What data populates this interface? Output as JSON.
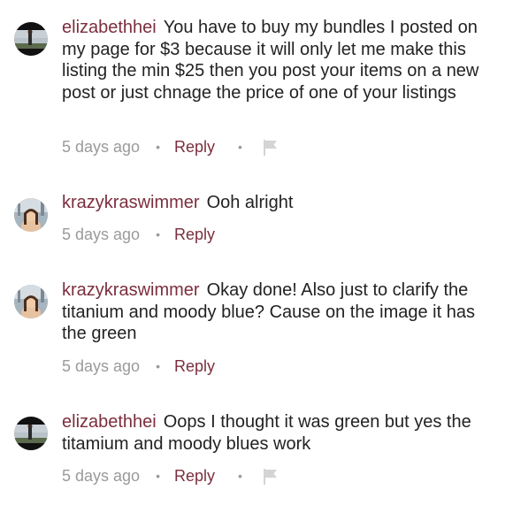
{
  "comments": [
    {
      "username": "elizabethhei",
      "text": "You have to buy my bundles I posted on my page for $3 because it will only let me make this listing the min $25 then you post your items on a new post or just chnage the price of one of your listings",
      "time": "5 days ago",
      "reply_label": "Reply",
      "separator": "•",
      "has_flag": true
    },
    {
      "username": "krazykraswimmer",
      "text": "Ooh alright",
      "time": "5 days ago",
      "reply_label": "Reply",
      "separator": "•",
      "has_flag": false
    },
    {
      "username": "krazykraswimmer",
      "text": "Okay done! Also just to clarify the titanium and moody blue? Cause on the image it has the green",
      "time": "5 days ago",
      "reply_label": "Reply",
      "separator": "•",
      "has_flag": false
    },
    {
      "username": "elizabethhei",
      "text": "Oops I thought it was green but yes the titamium and moody blues work",
      "time": "5 days ago",
      "reply_label": "Reply",
      "separator": "•",
      "has_flag": true
    }
  ],
  "colors": {
    "username": "#7b2e3e",
    "reply": "#7b2e3e",
    "body_text": "#222222",
    "muted": "#9a9a9a"
  },
  "icons": {
    "flag": "flag-icon",
    "avatar_elizabethhei": "avatar",
    "avatar_krazykraswimmer": "avatar"
  }
}
